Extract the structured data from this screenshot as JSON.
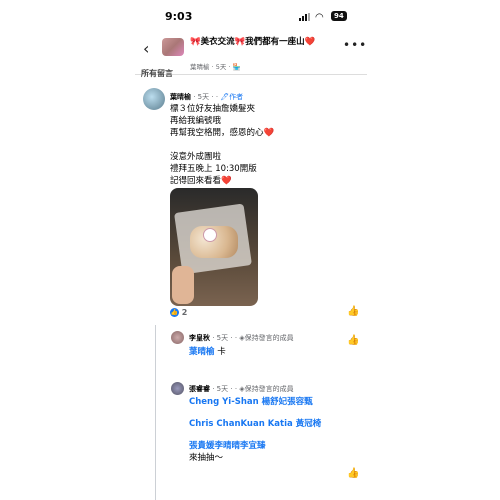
{
  "status": {
    "time": "9:03",
    "battery": "94"
  },
  "header": {
    "back_icon": "chevron-left-icon",
    "group_name": "🎀美衣交流🎀我們都有一座山❤️",
    "subtitle": "葉晴榆 · 5天 · 🏪",
    "more_icon": "more-icon"
  },
  "section_label": "所有留言",
  "post": {
    "author": "葉晴榆",
    "meta": "· 5天 · · ",
    "author_tag": "🖊作者",
    "lines": [
      "標３位好友抽詹嬌髮夾",
      "再給我編號哦",
      "再幫我空格開，感恩的心❤️",
      "",
      "沒意外成團啦",
      "禮拜五晚上 10:30開版",
      "記得回來看看❤️"
    ],
    "reactions": "2"
  },
  "replies": [
    {
      "name": "李皇秋",
      "meta": "· 5天 · · ◈保持發言的成員",
      "mention": "葉晴榆",
      "text": " 卡"
    },
    {
      "name": "張睿睿",
      "meta": "· 5天 · · ◈保持發言的成員",
      "lines": [
        "Cheng Yi-Shan 楊舒妃張容甄",
        "Chris ChanKuan Katia 黃冠椅",
        "張貴媛李晴晴李宜臻",
        "來抽抽～"
      ]
    }
  ],
  "colors": {
    "link": "#1877f2",
    "heart": "#e41e3f",
    "muted": "#65676b"
  }
}
